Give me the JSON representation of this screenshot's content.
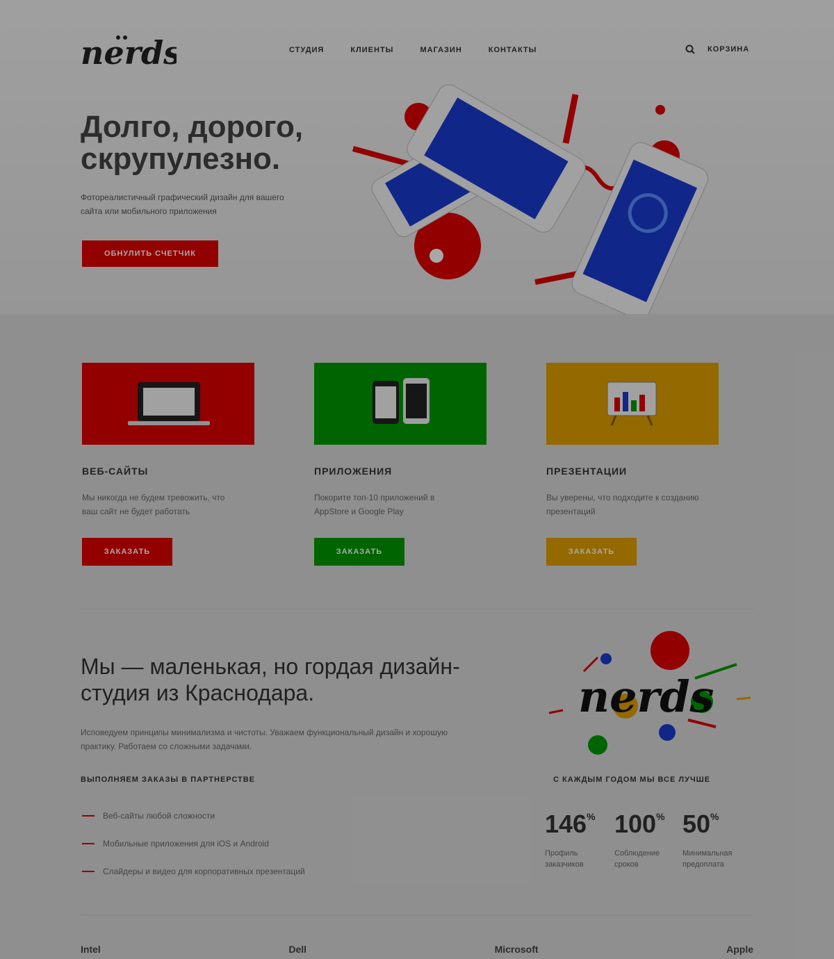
{
  "header": {
    "nav": [
      "СТУДИЯ",
      "КЛИЕНТЫ",
      "МАГАЗИН",
      "КОНТАКТЫ"
    ],
    "cart_label": "КОРЗИНА",
    "search_icon": "search-icon"
  },
  "hero": {
    "title": "Долго, дорого, скрупулезно.",
    "subtitle": "Фотореалистичный графический дизайн для вашего сайта или мобильного приложения",
    "button": "ОБНУЛИТЬ СЧЕТЧИК"
  },
  "services": [
    {
      "title": "ВЕБ-САЙТЫ",
      "text": "Мы никогда не будем тревожить, что ваш сайт не будет работать",
      "button": "ЗАКАЗАТЬ",
      "color": "#e00000",
      "icon": "laptop-icon"
    },
    {
      "title": "ПРИЛОЖЕНИЯ",
      "text": "Покорите топ-10 приложений в AppStore и Google Play",
      "button": "ЗАКАЗАТЬ",
      "color": "#009a00",
      "icon": "phones-icon"
    },
    {
      "title": "ПРЕЗЕНТАЦИИ",
      "text": "Вы уверены, что подходите к созданию презентаций",
      "button": "ЗАКАЗАТЬ",
      "color": "#e0a000",
      "icon": "presentation-icon"
    }
  ],
  "about": {
    "title": "Мы — маленькая, но гордая дизайн-студия из Краснодара.",
    "text": "Исповедуем принципы минимализма и чистоты. Уважаем функциональный дизайн и хорошую практику. Работаем со сложными задачами.",
    "list_title": "ВЫПОЛНЯЕМ ЗАКАЗЫ В ПАРТНЕРСТВЕ",
    "list": [
      "Веб-сайты любой сложности",
      "Мобильные приложения для iOS и Android",
      "Слайдеры и видео для корпоративных презентаций"
    ],
    "stats_title": "С КАЖДЫМ ГОДОМ МЫ ВСЕ ЛУЧШЕ",
    "stats": [
      {
        "value": "146",
        "unit": "%",
        "label": "Профиль заказчиков"
      },
      {
        "value": "100",
        "unit": "%",
        "label": "Соблюдение сроков"
      },
      {
        "value": "50",
        "unit": "%",
        "label": "Минимальная предоплата"
      }
    ]
  },
  "partners": [
    "Intel",
    "Dell",
    "Microsoft",
    "Apple"
  ]
}
